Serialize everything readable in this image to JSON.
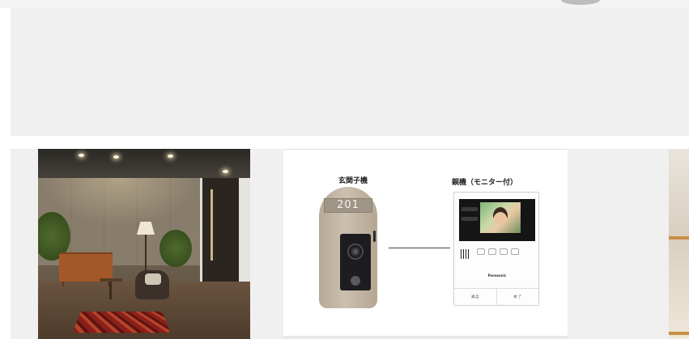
{
  "gallery": {
    "diagram": {
      "door_unit_caption": "玄関子機",
      "monitor_caption": "親機（モニター付）",
      "door_unit_number": "201",
      "monitor_brand": "Panasonic",
      "monitor_buttons": [
        "通 話",
        "終 了"
      ]
    }
  },
  "colors": {
    "banner_bg": "#f0f0f0",
    "door_unit_body": "#c2b6a3",
    "monitor_body": "#fdfdfd"
  }
}
